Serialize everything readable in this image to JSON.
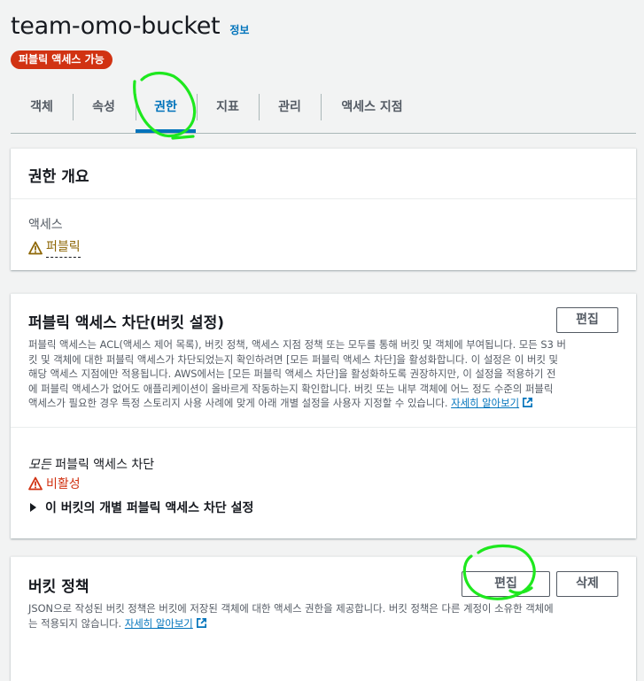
{
  "header": {
    "title": "team-omo-bucket",
    "info_link": "정보",
    "badge": "퍼블릭 액세스 가능"
  },
  "tabs": [
    "객체",
    "속성",
    "권한",
    "지표",
    "관리",
    "액세스 지점"
  ],
  "active_tab": "권한",
  "permissions_overview": {
    "heading": "권한 개요",
    "access_label": "액세스",
    "access_value": "퍼블릭"
  },
  "block_public_access": {
    "heading": "퍼블릭 액세스 차단(버킷 설정)",
    "edit_label": "편집",
    "description_lines": [
      "퍼블릭 액세스는 ACL(액세스 제어 목록), 버킷 정책, 액세스 지점 정책 또는 모두를 통해 버킷 및 객체에 부여됩니다. 모든 S3 버",
      "킷 및 객체에 대한 퍼블릭 액세스가 차단되었는지 확인하려면 [모든 퍼블릭 액세스 차단]을 활성화합니다. 이 설정은 이 버킷 및",
      "해당 액세스 지점에만 적용됩니다. AWS에서는 [모든 퍼블릭 액세스 차단]을 활성화하도록 권장하지만, 이 설정을 적용하기 전",
      "에 퍼블릭 액세스가 없어도 애플리케이션이 올바르게 작동하는지 확인합니다. 버킷 또는 내부 객체에 어느 정도 수준의 퍼블릭",
      "액세스가 필요한 경우 특정 스토리지 사용 사례에 맞게 아래 개별 설정을 사용자 지정할 수 있습니다."
    ],
    "learn_more": "자세히 알아보기",
    "setting_prefix": "모든",
    "setting_label": " 퍼블릭 액세스 차단",
    "setting_status": "비활성",
    "expander_label": "이 버킷의 개별 퍼블릭 액세스 차단 설정"
  },
  "bucket_policy": {
    "heading": "버킷 정책",
    "edit_label": "편집",
    "delete_label": "삭제",
    "description_line1": "JSON으로 작성된 버킷 정책은 버킷에 저장된 객체에 대한 액세스 권한을 제공합니다. 버킷 정책은 다른 계정이 소유한 객체에",
    "description_line2": "는 적용되지 않습니다.",
    "learn_more": "자세히 알아보기"
  },
  "colors": {
    "link": "#0073bb",
    "badge_bg": "#d13212",
    "warning": "#8d6605",
    "error": "#d13212",
    "annotation": "#1ee81e"
  }
}
